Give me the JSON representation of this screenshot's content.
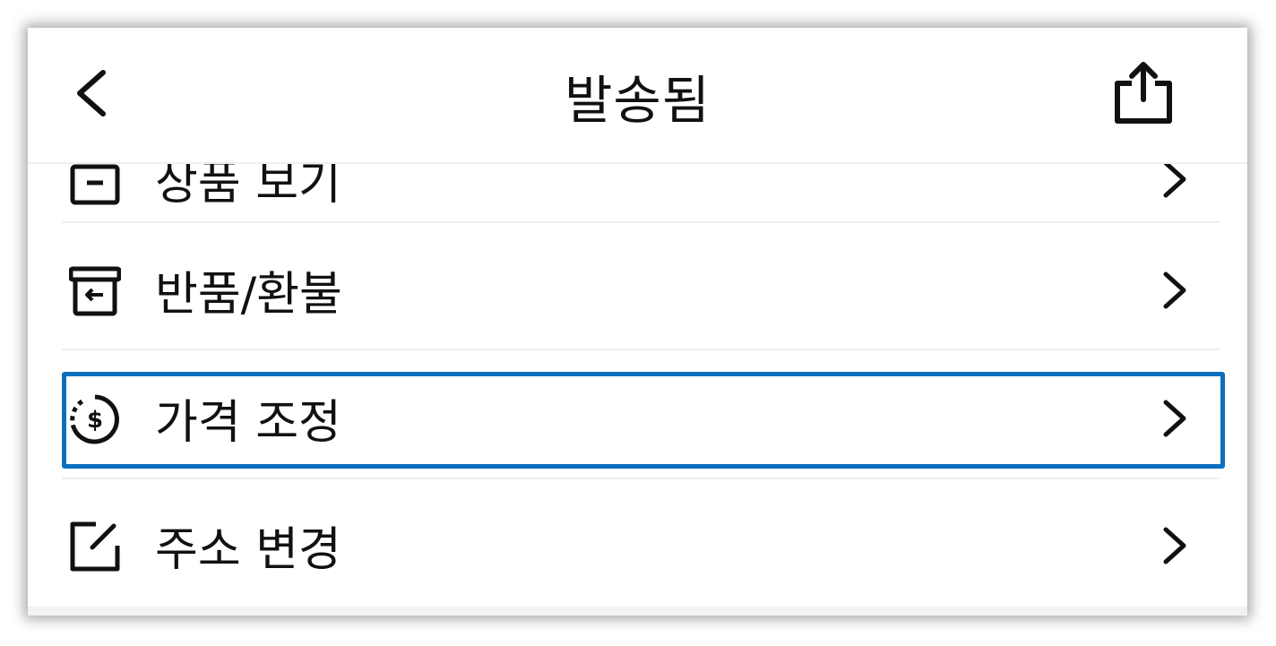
{
  "header": {
    "title": "발송됨",
    "back_icon": "chevron-left-icon",
    "share_icon": "share-icon"
  },
  "menu": {
    "items": [
      {
        "label": "상품 보기",
        "icon": "box-icon"
      },
      {
        "label": "반품/환불",
        "icon": "return-box-icon"
      },
      {
        "label": "가격 조정",
        "icon": "dollar-circle-icon"
      },
      {
        "label": "주소 변경",
        "icon": "edit-icon"
      }
    ]
  },
  "colors": {
    "highlight": "#0a6fbf",
    "text": "#111111",
    "divider": "#eeeeee"
  }
}
